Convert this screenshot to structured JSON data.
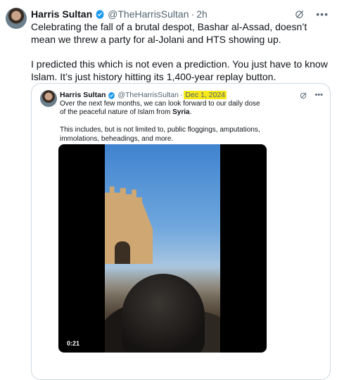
{
  "tweet": {
    "author_name": "Harris Sultan",
    "handle": "@TheHarrisSultan",
    "separator": "·",
    "time": "2h",
    "paragraphs": [
      "Celebrating the fall of a brutal despot, Bashar al-Assad, doesn’t mean we threw a party for al-Jolani and HTS showing up.",
      "I predicted this which is not even a prediction. You just have to know Islam. It’s just history hitting its 1,400-year replay button."
    ],
    "icons": {
      "verified": "verified-badge-icon",
      "grok": "grok-icon",
      "more": "more-icon"
    }
  },
  "quoted": {
    "author_name": "Harris Sultan",
    "handle": "@TheHarrisSultan",
    "separator": "·",
    "date": "Dec 1, 2024",
    "paragraph1_prefix": "Over the next few months, we can look forward to our daily dose of the peaceful nature of Islam from ",
    "paragraph1_bold": "Syria",
    "paragraph1_suffix": ".",
    "paragraph2": "This includes, but is not limited to, public floggings, amputations, immolations, beheadings, and more.",
    "video_time": "0:21",
    "highlight_color": "#f6e81a"
  },
  "colors": {
    "verified": "#1d9bf0",
    "secondary_text": "#536471",
    "border": "#cfd9de"
  }
}
